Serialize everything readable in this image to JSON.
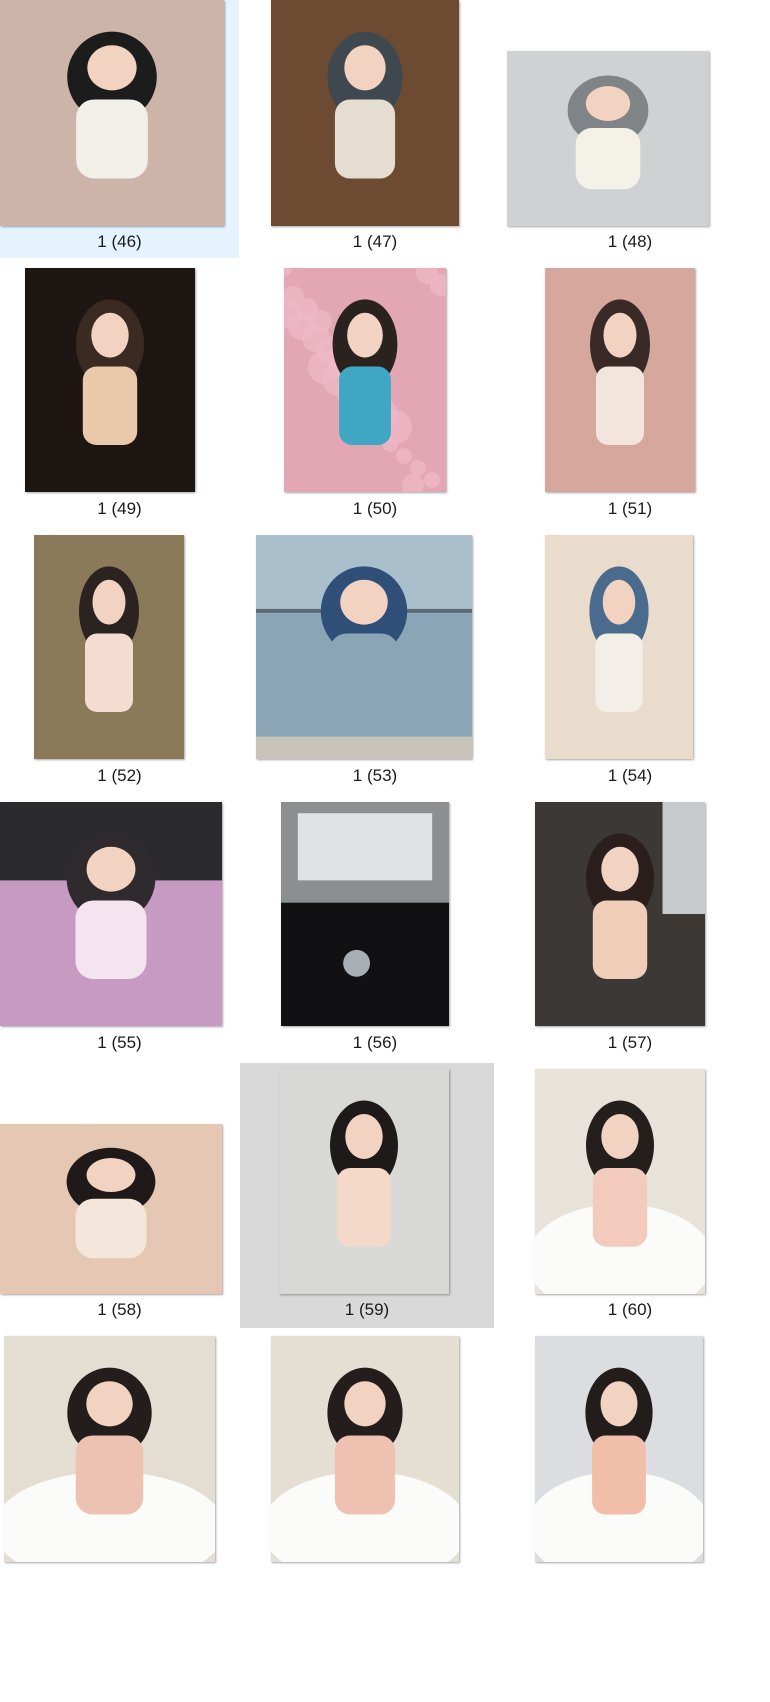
{
  "view": "large-icons",
  "files": [
    {
      "name": "1 (46)",
      "state": "selected",
      "icon": "photo-thumbnail",
      "scene": "street-boba",
      "colors": [
        "#cdb4a8",
        "#f2efe9",
        "#1c1c1c"
      ]
    },
    {
      "name": "1 (47)",
      "state": "normal",
      "icon": "photo-thumbnail",
      "scene": "mirror-bed",
      "colors": [
        "#6d4b32",
        "#e4ddd0",
        "#40484f"
      ]
    },
    {
      "name": "1 (48)",
      "state": "normal",
      "icon": "photo-thumbnail",
      "scene": "lobby-dress",
      "colors": [
        "#cfd2d2",
        "#f4f1e8",
        "#7f8486"
      ]
    },
    {
      "name": "1 (49)",
      "state": "normal",
      "icon": "photo-thumbnail",
      "scene": "dim-cafe",
      "colors": [
        "#1e1612",
        "#e9c9a9",
        "#3b2a22"
      ]
    },
    {
      "name": "1 (50)",
      "state": "normal",
      "icon": "photo-thumbnail",
      "scene": "flower-field",
      "colors": [
        "#e3a6b4",
        "#3fa6c3",
        "#2a221f"
      ]
    },
    {
      "name": "1 (51)",
      "state": "normal",
      "icon": "photo-thumbnail",
      "scene": "portrait-pink",
      "colors": [
        "#d6a79d",
        "#f3e5dc",
        "#3a2a27"
      ]
    },
    {
      "name": "1 (52)",
      "state": "normal",
      "icon": "photo-thumbnail",
      "scene": "closeup-flower",
      "colors": [
        "#8b7a5a",
        "#f4ddd0",
        "#2b2320"
      ]
    },
    {
      "name": "1 (53)",
      "state": "normal",
      "icon": "photo-thumbnail",
      "scene": "beach",
      "colors": [
        "#a9bfcc",
        "#8aa6b6",
        "#2f4f78"
      ]
    },
    {
      "name": "1 (54)",
      "state": "normal",
      "icon": "photo-thumbnail",
      "scene": "mirror-denim",
      "colors": [
        "#e9dccd",
        "#f3efe8",
        "#4b6b8e"
      ]
    },
    {
      "name": "1 (55)",
      "state": "normal",
      "icon": "photo-thumbnail",
      "scene": "night-walk",
      "colors": [
        "#c69ac2",
        "#f4e4f0",
        "#2f2a2d"
      ]
    },
    {
      "name": "1 (56)",
      "state": "normal",
      "icon": "photo-thumbnail",
      "scene": "dark-hall",
      "colors": [
        "#2c2c30",
        "#dfe3e6",
        "#111114"
      ]
    },
    {
      "name": "1 (57)",
      "state": "normal",
      "icon": "photo-thumbnail",
      "scene": "car-selfie",
      "colors": [
        "#3b3835",
        "#f0cdb8",
        "#2a1f1c"
      ]
    },
    {
      "name": "1 (58)",
      "state": "normal",
      "icon": "photo-thumbnail",
      "scene": "lying-closeup",
      "colors": [
        "#e6c7b3",
        "#f5e6dc",
        "#1f1a19"
      ]
    },
    {
      "name": "1 (59)",
      "state": "hovered",
      "icon": "photo-thumbnail",
      "scene": "peace-sign",
      "colors": [
        "#d8d8d6",
        "#f4d9c8",
        "#1e1a1a"
      ]
    },
    {
      "name": "1 (60)",
      "state": "normal",
      "icon": "photo-thumbnail",
      "scene": "bathtub-a",
      "colors": [
        "#e7e2da",
        "#f3cbbd",
        "#241e1c"
      ]
    },
    {
      "name": "",
      "state": "normal",
      "icon": "photo-thumbnail",
      "scene": "bathtub-b",
      "colors": [
        "#e3ddd2",
        "#eec2b2",
        "#231d1b"
      ]
    },
    {
      "name": "",
      "state": "normal",
      "icon": "photo-thumbnail",
      "scene": "bathtub-c",
      "colors": [
        "#e4ded3",
        "#efc1b0",
        "#241d1b"
      ]
    },
    {
      "name": "",
      "state": "normal",
      "icon": "photo-thumbnail",
      "scene": "bathtub-d",
      "colors": [
        "#dcdde0",
        "#f1bfa9",
        "#221c1b"
      ]
    }
  ]
}
